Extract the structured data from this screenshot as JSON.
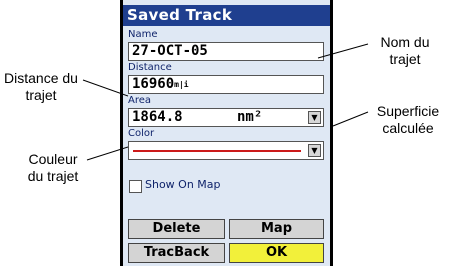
{
  "window": {
    "title": "Saved Track"
  },
  "fields": {
    "name": {
      "label": "Name",
      "value": "27-OCT-05"
    },
    "distance": {
      "label": "Distance",
      "value": "16960",
      "unit": "m|i"
    },
    "area": {
      "label": "Area",
      "value": "1864.8",
      "unit": "nm²"
    },
    "color": {
      "label": "Color"
    }
  },
  "checkbox": {
    "label": "Show On Map",
    "checked": false
  },
  "buttons": {
    "delete": "Delete",
    "map": "Map",
    "tracback": "TracBack",
    "ok": "OK"
  },
  "annotations": {
    "nom_du_trajet": "Nom du trajet",
    "distance_du_trajet": "Distance du trajet",
    "superficie": "Superficie calculée",
    "couleur": "Couleur du trajet"
  },
  "colors": {
    "titlebar": "#1f3f8f",
    "panel": "#dfe8f4",
    "track": "#cc1a1a",
    "ok_button": "#f2f03a"
  },
  "icons": {
    "dropdown": "chevron-down-icon"
  }
}
